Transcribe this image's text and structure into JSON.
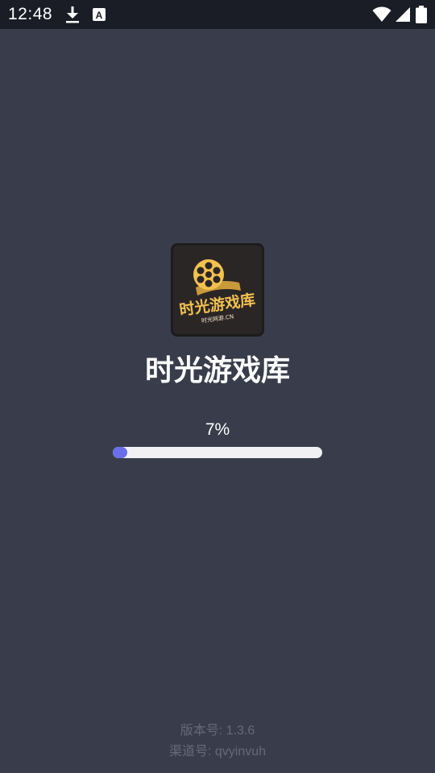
{
  "status_bar": {
    "time": "12:48",
    "icons": [
      "download-icon",
      "a-notification-icon",
      "wifi-icon",
      "signal-icon",
      "battery-icon"
    ]
  },
  "logo": {
    "main_text": "时光游戏库",
    "sub_text": "时光网游.CN",
    "icon": "film-reel-icon",
    "colors": {
      "gold": "#f2c14e",
      "background": "#2b2626"
    }
  },
  "app": {
    "title": "时光游戏库"
  },
  "progress": {
    "label": "7%",
    "value": 0.07,
    "fill_color": "#6a6ee8",
    "track_color": "#f1f1f3"
  },
  "footer": {
    "version": "版本号: 1.3.6",
    "channel": "渠道号: qvyinvuh"
  },
  "colors": {
    "background": "#393d4b",
    "status_bar": "#1a1c26",
    "footer_text": "#656a78"
  }
}
